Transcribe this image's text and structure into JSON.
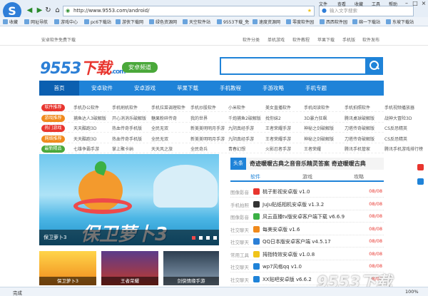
{
  "browser": {
    "logo": "S",
    "url": "http://www.9553.com/android/",
    "search_placeholder": "输入文字搜索",
    "menus": [
      "文件",
      "查看",
      "收藏",
      "工具",
      "帮助"
    ],
    "bookmarks": [
      "收藏",
      "网址导航",
      "游戏中心",
      "pc6下载站",
      "游侠下载网",
      "绿色资源网",
      "天空软件站",
      "9553下载_免",
      "速度资源网",
      "零度软件园",
      "西西软件园",
      "绵一下载站",
      "东坡下载站"
    ],
    "status_left": "完成",
    "zoom": "100%"
  },
  "page": {
    "top_left": "安卓软件免费下载",
    "top_links": [
      "软件分类",
      "单机游戏",
      "软件教程",
      "苹果下载",
      "手机版",
      "软件发布"
    ],
    "logo_num": "9553",
    "logo_text": "下载",
    "logo_sub": ".com",
    "channel": "安卓频道",
    "nav": [
      "首页",
      "安卓软件",
      "安卓游戏",
      "苹果下载",
      "手机教程",
      "手游攻略",
      "手机专题"
    ],
    "categories": [
      {
        "tag": "软件推荐",
        "color": "#e8352e",
        "links": [
          "手机办公软件",
          "手机刷机软件",
          "手机拉菜调理软件",
          "手机炒股软件",
          "小米软件",
          "美女直播软件",
          "手机阅读软件",
          "手机拍照软件",
          "手机视频播放器"
        ]
      },
      {
        "tag": "游戏推荐",
        "color": "#f08a1c",
        "links": [
          "捕鱼达人3破解版",
          "开心消消乐破解版",
          "糖果粉碎传奇",
          "我的世界",
          "千炮捕鱼2破解版",
          "找你妹2",
          "3D暴力狂飙",
          "腾讯桌球破解版",
          "战神大冒险3D"
        ]
      },
      {
        "tag": "热门游戏",
        "color": "#e8352e",
        "links": [
          "天天酷跑3D",
          "热血传奇手机版",
          "全民无双",
          "新美美明明月手游",
          "九阴真经手游",
          "王者荣耀手游",
          "神秘之剑破解版",
          "刀塔传奇破解版",
          "CS反恐精英"
        ]
      },
      {
        "tag": "网络推荐",
        "color": "#f08a1c",
        "links": [
          "天天酷跑3D",
          "热血传奇手机版",
          "全民无双",
          "新美美明明月手游",
          "九阴真经手游",
          "王者荣耀手游",
          "神秘之剑破解版",
          "刀塔传奇破解版",
          "CS反恐精英"
        ]
      },
      {
        "tag": "最新精品",
        "color": "#4aa83a",
        "links": [
          "七雄争霸手游",
          "掌上聚卡纳",
          "天天风之旅",
          "全民奇兵",
          "青春幻想",
          "火影忍者手游",
          "王者荣耀",
          "腾讯手机管家",
          "腾讯手机游戏排行榜"
        ]
      }
    ],
    "banner_title": "保卫萝卜3",
    "banner_caption": "保卫萝卜3",
    "thumbs": [
      "保卫萝卜3",
      "王者荣耀",
      "剑侠情缘手游"
    ],
    "headline_tag": "头条",
    "headline": "奇迹暖暖古典之音音乐精灵答案 奇迹暖暖古典",
    "tabs": [
      "软件",
      "游戏",
      "攻略"
    ],
    "apps": [
      {
        "cat": "图像影音",
        "name": "桃子影视安卓版 v1.0",
        "date": "08/08",
        "color": "#e8352e"
      },
      {
        "cat": "手机拍照",
        "name": "JuJu贴纸相机安卓版 v1.3.2",
        "date": "08/08",
        "color": "#333333"
      },
      {
        "cat": "图像影音",
        "name": "风云直播tv版安卓客户端下载 v6.6.9",
        "date": "08/08",
        "color": "#3bb045"
      },
      {
        "cat": "社交聊天",
        "name": "每美安卓版 v1.6",
        "date": "08/08",
        "color": "#f08a1c"
      },
      {
        "cat": "社交聊天",
        "name": "QQ日本版安卓客户端 v4.5.17",
        "date": "08/08",
        "color": "#2b7fd6"
      },
      {
        "cat": "常用工具",
        "name": "拇指特效安卓版 v1.0.8",
        "date": "08/08",
        "color": "#f0c419"
      },
      {
        "cat": "社交聊天",
        "name": "wp7风格qq v1.0",
        "date": "08/08",
        "color": "#1f83d8"
      },
      {
        "cat": "社交聊天",
        "name": "XX贴吧安卓版 v6.6.2",
        "date": "08/08",
        "color": "#1f83d8"
      }
    ],
    "watermark": "9553下载"
  }
}
